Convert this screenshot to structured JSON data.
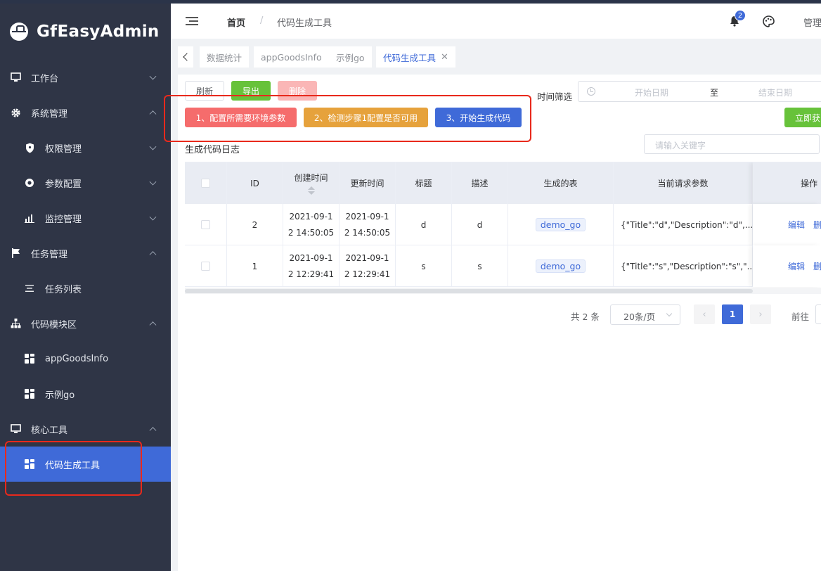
{
  "app": {
    "title": "GfEasyAdmin"
  },
  "sidebar": {
    "items": [
      {
        "label": "工作台"
      },
      {
        "label": "系统管理"
      },
      {
        "label": "权限管理"
      },
      {
        "label": "参数配置"
      },
      {
        "label": "监控管理"
      },
      {
        "label": "任务管理"
      },
      {
        "label": "任务列表"
      },
      {
        "label": "代码模块区"
      },
      {
        "label": "appGoodsInfo"
      },
      {
        "label": "示例go"
      },
      {
        "label": "核心工具"
      },
      {
        "label": "代码生成工具"
      }
    ]
  },
  "navbar": {
    "breadcrumb_home": "首页",
    "breadcrumb_sep": "/",
    "breadcrumb_current": "代码生成工具",
    "notification_count": "2",
    "user_label": "管理"
  },
  "tags": [
    {
      "label": "数据统计"
    },
    {
      "label": "appGoodsInfo"
    },
    {
      "label": "示例go"
    },
    {
      "label": "代码生成工具"
    }
  ],
  "toolbar": {
    "refresh": "刷新",
    "export": "导出",
    "delete": "删除",
    "step1": "1、配置所需要环境参数",
    "step2": "2、检测步骤1配置是否可用",
    "step3": "3、开始生成代码",
    "generate_now": "立即获"
  },
  "filter": {
    "time_label": "时间筛选",
    "start_placeholder": "开始日期",
    "range_sep": "至",
    "end_placeholder": "结束日期"
  },
  "section": {
    "title": "生成代码日志",
    "search_placeholder": "请输入关键字"
  },
  "table": {
    "headers": {
      "id": "ID",
      "created": "创建时间",
      "updated": "更新时间",
      "title": "标题",
      "desc": "描述",
      "table": "生成的表",
      "params": "当前请求参数",
      "ops": "操作"
    },
    "rows": [
      {
        "id": "2",
        "created_1": "2021-09-1",
        "created_2": "2 14:50:05",
        "updated_1": "2021-09-1",
        "updated_2": "2 14:50:05",
        "title": "d",
        "desc": "d",
        "table": "demo_go",
        "params": "{\"Title\":\"d\",\"Description\":\"d\",...",
        "edit": "编辑",
        "delete": "删"
      },
      {
        "id": "1",
        "created_1": "2021-09-1",
        "created_2": "2 12:29:41",
        "updated_1": "2021-09-1",
        "updated_2": "2 12:29:41",
        "title": "s",
        "desc": "s",
        "table": "demo_go",
        "params": "{\"Title\":\"s\",\"Description\":\"s\",\"...",
        "edit": "编辑",
        "delete": "删"
      }
    ]
  },
  "pagination": {
    "total": "共 2 条",
    "page_size": "20条/页",
    "prev": "‹",
    "current": "1",
    "next": "›",
    "goto": "前往"
  },
  "colors": {
    "sidebar_bg": "#2f3546",
    "accent": "#3f6ad8",
    "annotation": "#e8291c"
  }
}
